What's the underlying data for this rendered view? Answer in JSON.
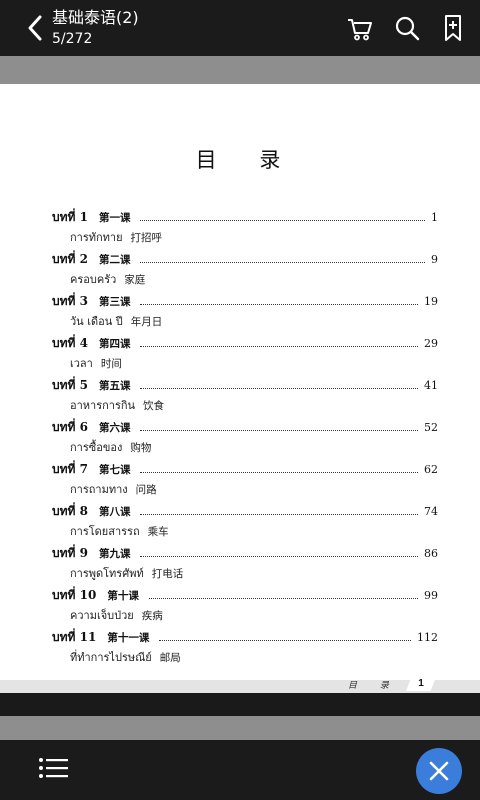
{
  "topbar": {
    "title": "基础泰语(2)",
    "page_info": "5/272"
  },
  "toc": {
    "heading": "目 录",
    "entries": [
      {
        "lesson": "บทที่ 1",
        "chinese": "第一课",
        "page": "1",
        "thai_title": "การทักทาย",
        "zh_title": "打招呼"
      },
      {
        "lesson": "บทที่ 2",
        "chinese": "第二课",
        "page": "9",
        "thai_title": "ครอบครัว",
        "zh_title": "家庭"
      },
      {
        "lesson": "บทที่ 3",
        "chinese": "第三课",
        "page": "19",
        "thai_title": "วัน เดือน ปี",
        "zh_title": "年月日"
      },
      {
        "lesson": "บทที่ 4",
        "chinese": "第四课",
        "page": "29",
        "thai_title": "เวลา",
        "zh_title": "时间"
      },
      {
        "lesson": "บทที่ 5",
        "chinese": "第五课",
        "page": "41",
        "thai_title": "อาหารการกิน",
        "zh_title": "饮食"
      },
      {
        "lesson": "บทที่ 6",
        "chinese": "第六课",
        "page": "52",
        "thai_title": "การซื้อของ",
        "zh_title": "购物"
      },
      {
        "lesson": "บทที่ 7",
        "chinese": "第七课",
        "page": "62",
        "thai_title": "การถามทาง",
        "zh_title": "问路"
      },
      {
        "lesson": "บทที่ 8",
        "chinese": "第八课",
        "page": "74",
        "thai_title": "การโดยสารรถ",
        "zh_title": "乘车"
      },
      {
        "lesson": "บทที่ 9",
        "chinese": "第九课",
        "page": "86",
        "thai_title": "การพูดโทรศัพท์",
        "zh_title": "打电话"
      },
      {
        "lesson": "บทที่ 10",
        "chinese": "第十课",
        "page": "99",
        "thai_title": "ความเจ็บป่วย",
        "zh_title": "疾病"
      },
      {
        "lesson": "บทที่ 11",
        "chinese": "第十一课",
        "page": "112",
        "thai_title": "ที่ทำการไปรษณีย์",
        "zh_title": "邮局"
      }
    ]
  },
  "footer": {
    "label": "目 录",
    "page_number": "1"
  },
  "icons": {
    "back": "chevron-left-icon",
    "cart": "cart-icon",
    "search": "search-icon",
    "bookmark": "bookmark-add-icon",
    "menu": "list-menu-icon",
    "close": "close-icon"
  },
  "colors": {
    "bar": "#1b1b1b",
    "fab": "#3b7ddb",
    "gray_strip": "#8e8e8e"
  }
}
